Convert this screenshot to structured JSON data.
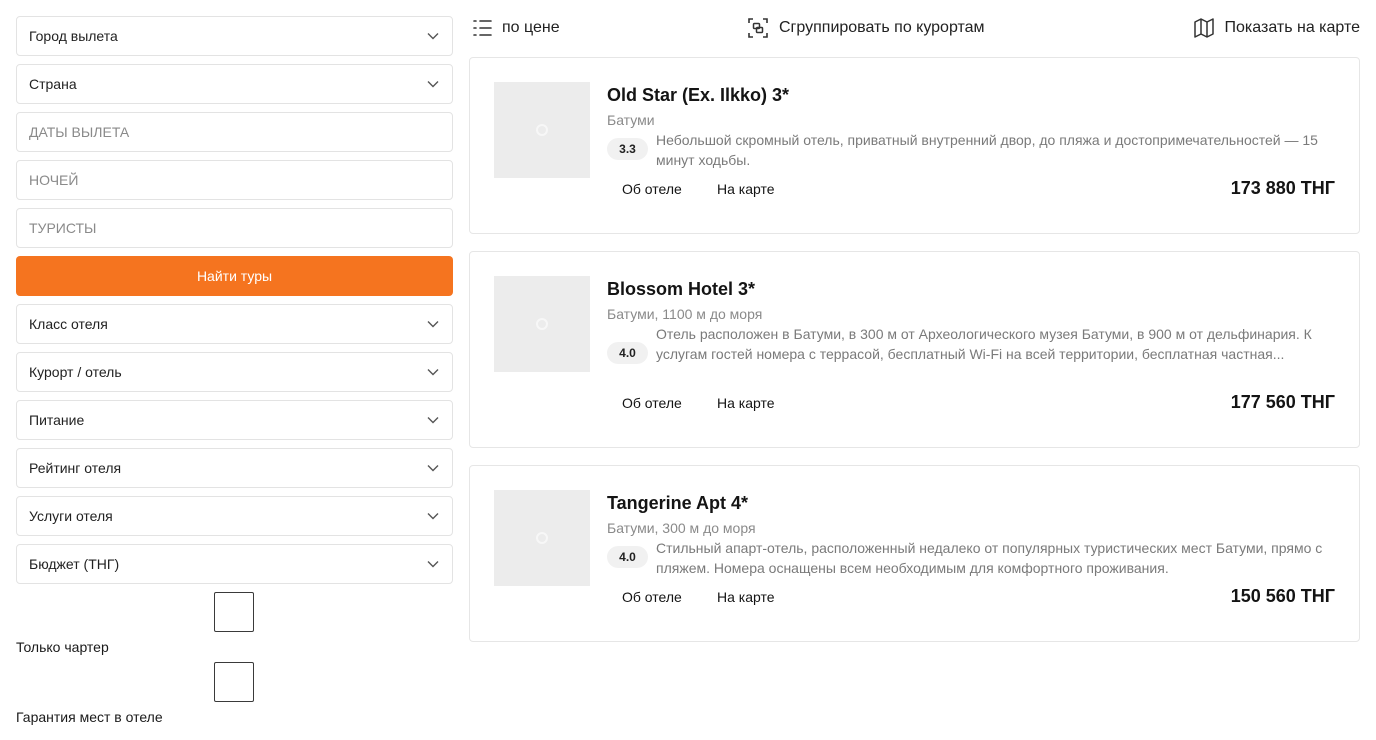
{
  "filters": {
    "departure_city": "Город вылета",
    "country": "Страна",
    "dates_placeholder": "ДАТЫ ВЫЛЕТА",
    "nights_placeholder": "НОЧЕЙ",
    "tourists_placeholder": "ТУРИСТЫ",
    "search_button": "Найти туры",
    "hotel_class": "Класс отеля",
    "resort_hotel": "Курорт / отель",
    "meals": "Питание",
    "hotel_rating": "Рейтинг отеля",
    "hotel_services": "Услуги отеля",
    "budget": "Бюджет (ТНГ)",
    "charter_only": "Только чартер",
    "guaranteed_rooms": "Гарантия мест в отеле"
  },
  "toolbar": {
    "sort_label": "по цене",
    "group_label": "Сгруппировать по курортам",
    "map_label": "Показать на карте"
  },
  "hotels": [
    {
      "name": "Old Star (Ex. Ilkko) 3*",
      "location": "Батуми",
      "rating": "3.3",
      "description": "Небольшой скромный отель, приватный внутренний двор, до пляжа и достопримечательностей — 15 минут ходьбы.",
      "about_link": "Об отеле",
      "map_link": "На карте",
      "price": "173 880 ТНГ"
    },
    {
      "name": "Blossom Hotel 3*",
      "location": "Батуми, 1100 м до моря",
      "rating": "4.0",
      "description": "Отель расположен в Батуми, в 300 м от Археологического музея Батуми, в 900 м от дельфинария. К услугам гостей номера с террасой, бесплатный Wi-Fi на всей территории, бесплатная частная...",
      "about_link": "Об отеле",
      "map_link": "На карте",
      "price": "177 560 ТНГ"
    },
    {
      "name": "Tangerine Apt 4*",
      "location": "Батуми, 300 м до моря",
      "rating": "4.0",
      "description": "Стильный апарт-отель, расположенный недалеко от популярных туристических мест Батуми, прямо с пляжем. Номера оснащены всем необходимым для комфортного проживания.",
      "about_link": "Об отеле",
      "map_link": "На карте",
      "price": "150 560 ТНГ"
    }
  ],
  "colors": {
    "accent": "#f5741f",
    "border": "#e3e3e3",
    "muted_text": "#8a8a8a"
  },
  "icons": {
    "chevron": "chevron-down-icon",
    "sort": "sort-list-icon",
    "group": "group-icon",
    "map": "map-icon",
    "photo": "image-placeholder-icon"
  }
}
